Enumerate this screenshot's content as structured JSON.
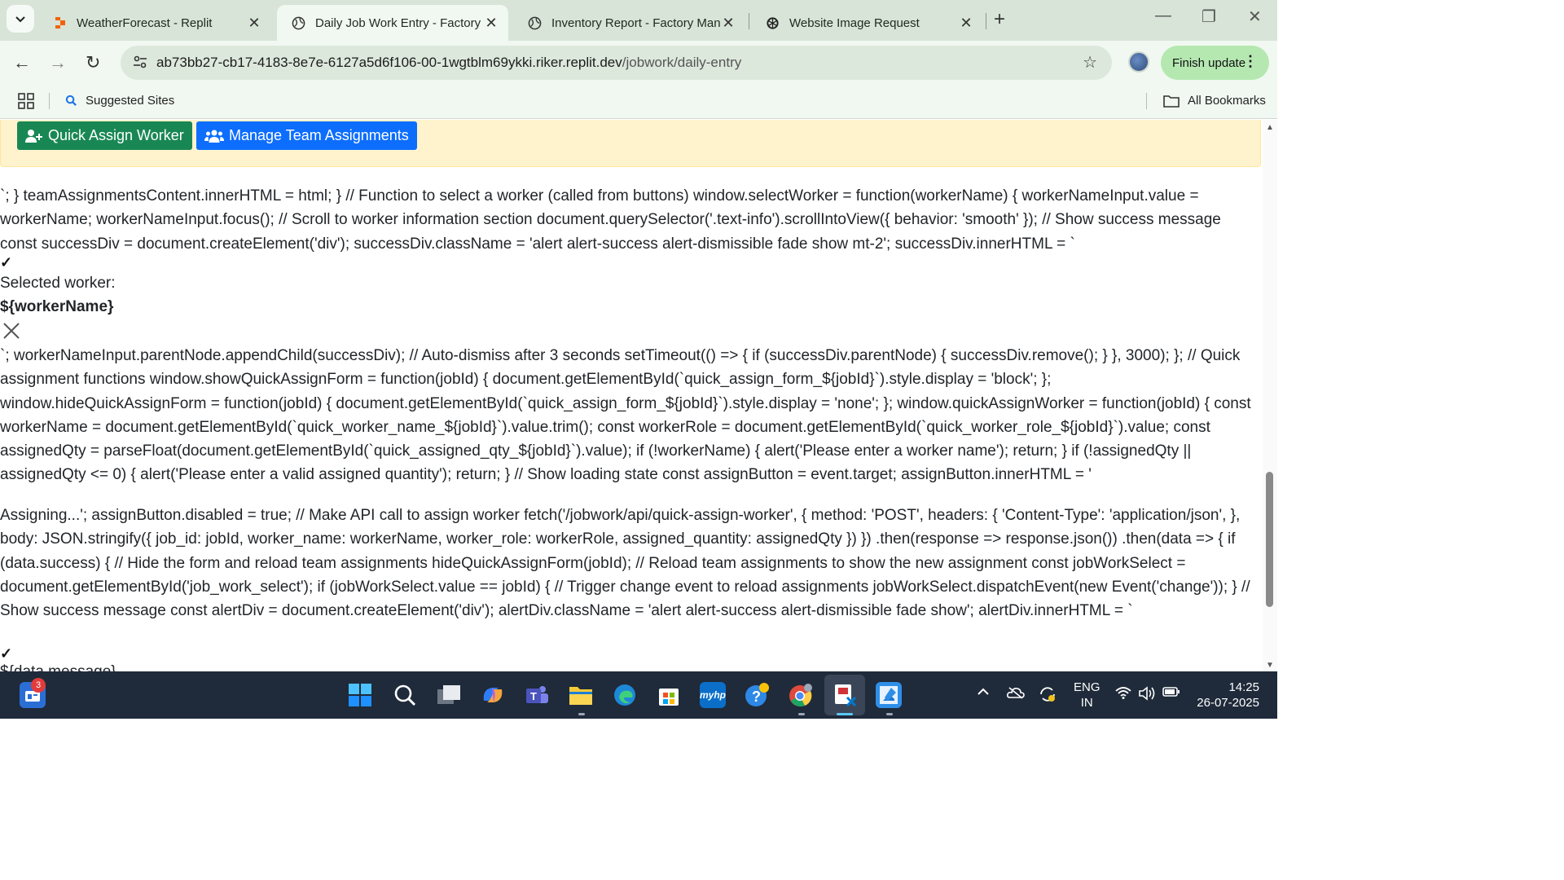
{
  "tabs": [
    {
      "title": "WeatherForecast - Replit",
      "icon": "replit-icon"
    },
    {
      "title": "Daily Job Work Entry - Factory Ma",
      "icon": "globe-icon",
      "active": true
    },
    {
      "title": "Inventory Report - Factory Mana",
      "icon": "globe-icon"
    },
    {
      "title": "Website Image Request",
      "icon": "openai-icon"
    }
  ],
  "tab_close_glyph": "✕",
  "new_tab_glyph": "+",
  "window": {
    "minimize": "—",
    "restore": "❐",
    "close": "✕"
  },
  "toolbar": {
    "back": "←",
    "forward": "→",
    "reload": "↻",
    "url_host": "ab73bb27-cb17-4183-8e7e-6127a5d6f106-00-1wgtblm69ykki.riker.replit.dev",
    "url_path": "/jobwork/daily-entry",
    "star": "☆",
    "finish_update": "Finish update",
    "menu": "⋮"
  },
  "bookmarks": {
    "suggested": "Suggested Sites",
    "all": "All Bookmarks"
  },
  "page": {
    "quick_assign": "Quick Assign Worker",
    "manage_team": "Manage Team Assignments",
    "code_block_1": "`; } teamAssignmentsContent.innerHTML = html; } // Function to select a worker (called from buttons) window.selectWorker = function(workerName) { workerNameInput.value = workerName; workerNameInput.focus(); // Scroll to worker information section document.querySelector('.text-info').scrollIntoView({ behavior: 'smooth' }); // Show success message const successDiv = document.createElement('div'); successDiv.className = 'alert alert-success alert-dismissible fade show mt-2'; successDiv.innerHTML = `",
    "check_1": "✓",
    "selected_worker": "Selected worker:",
    "worker_name_tpl": "${workerName}",
    "code_block_2": "`; workerNameInput.parentNode.appendChild(successDiv); // Auto-dismiss after 3 seconds setTimeout(() => { if (successDiv.parentNode) { successDiv.remove(); } }, 3000); }; // Quick assignment functions window.showQuickAssignForm = function(jobId) { document.getElementById(`quick_assign_form_${jobId}`).style.display = 'block'; }; window.hideQuickAssignForm = function(jobId) { document.getElementById(`quick_assign_form_${jobId}`).style.display = 'none'; }; window.quickAssignWorker = function(jobId) { const workerName = document.getElementById(`quick_worker_name_${jobId}`).value.trim(); const workerRole = document.getElementById(`quick_worker_role_${jobId}`).value; const assignedQty = parseFloat(document.getElementById(`quick_assigned_qty_${jobId}`).value); if (!workerName) { alert('Please enter a worker name'); return; } if (!assignedQty || assignedQty <= 0) { alert('Please enter a valid assigned quantity'); return; } // Show loading state const assignButton = event.target; assignButton.innerHTML = '",
    "code_block_3": "Assigning...'; assignButton.disabled = true; // Make API call to assign worker fetch('/jobwork/api/quick-assign-worker', { method: 'POST', headers: { 'Content-Type': 'application/json', }, body: JSON.stringify({ job_id: jobId, worker_name: workerName, worker_role: workerRole, assigned_quantity: assignedQty }) }) .then(response => response.json()) .then(data => { if (data.success) { // Hide the form and reload team assignments hideQuickAssignForm(jobId); // Reload team assignments to show the new assignment const jobWorkSelect = document.getElementById('job_work_select'); if (jobWorkSelect.value == jobId) { // Trigger change event to reload assignments jobWorkSelect.dispatchEvent(new Event('change')); } // Show success message const alertDiv = document.createElement('div'); alertDiv.className = 'alert alert-success alert-dismissible fade show'; alertDiv.innerHTML = `",
    "check_2": "✓",
    "cut_line": "${data.message}"
  },
  "taskbar": {
    "badge": "3",
    "lang_1": "ENG",
    "lang_2": "IN",
    "time": "14:25",
    "date": "26-07-2025"
  },
  "colors": {
    "green_btn": "#198754",
    "blue_btn": "#0d6efd",
    "alert_bg": "#fff3cd",
    "finish_btn": "#b5e8b1"
  }
}
